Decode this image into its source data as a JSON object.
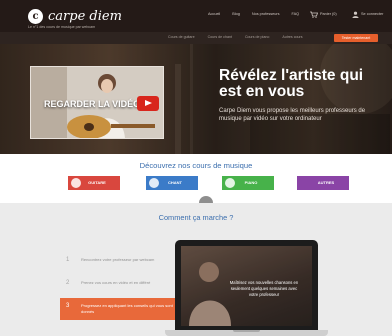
{
  "brand": {
    "mark": "c",
    "name": "carpe diem",
    "tagline": "Le n°1 des cours de musique par webcam"
  },
  "topnav": {
    "items": [
      "Accueil",
      "Blog",
      "Nos professeurs",
      "FAQ"
    ],
    "cart_label": "Panier (0)",
    "user_label": "Se connecter"
  },
  "subnav": {
    "items": [
      "Cours de guitare",
      "Cours de chant",
      "Cours de piano",
      "Autres cours"
    ],
    "cta_label": "Tester maintenant"
  },
  "hero": {
    "video_label": "REGARDER LA VIDÉO",
    "title": "Révélez l'artiste qui est en vous",
    "subtitle": "Carpe Diem vous propose les meilleurs professeurs de musique par vidéo sur votre ordinateur"
  },
  "courses": {
    "title": "Découvrez nos cours de musique",
    "items": [
      {
        "label": "GUITARE",
        "color": "#d9473e"
      },
      {
        "label": "CHANT",
        "color": "#3b7bc8"
      },
      {
        "label": "PIANO",
        "color": "#47b24a"
      },
      {
        "label": "AUTRES",
        "color": "#8a44a6"
      }
    ]
  },
  "how": {
    "title": "Comment ça marche ?",
    "steps": [
      {
        "num": "1",
        "text": "Rencontrez votre professeur par webcam"
      },
      {
        "num": "2",
        "text": "Prenez vos cours en vidéo et en différé"
      },
      {
        "num": "3",
        "text": "Progressez en appliquant les conseils qui vous sont donnés"
      }
    ],
    "laptop_text": "Maîtrisez vos nouvelles chansons en seulement quelques semaines avec votre professeur"
  },
  "colors": {
    "accent": "#e65f2c",
    "heading": "#3c6fae",
    "topbar": "#241a17"
  }
}
